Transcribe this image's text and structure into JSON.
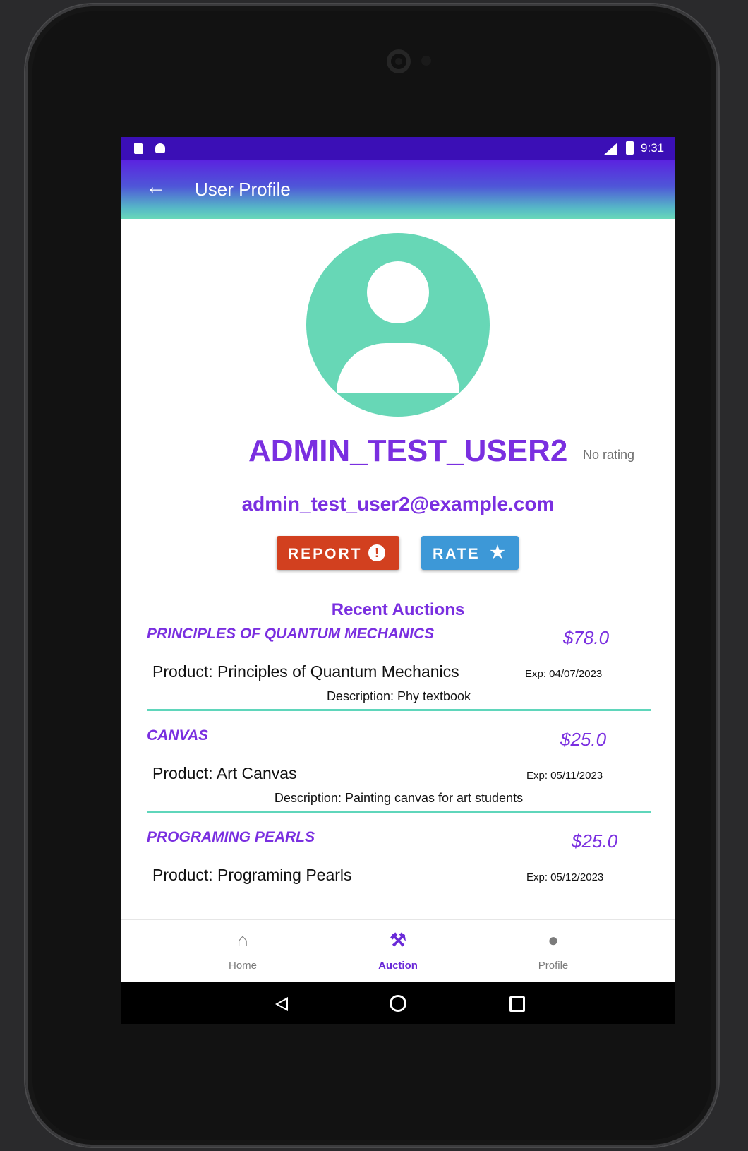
{
  "status_bar": {
    "time": "9:31"
  },
  "app_bar": {
    "title": "User Profile",
    "back_icon": "arrow-left-icon"
  },
  "profile": {
    "username": "ADMIN_TEST_USER2",
    "rating_text": "No rating",
    "email": "admin_test_user2@example.com",
    "avatar_icon": "person-avatar-icon",
    "avatar_color": "#67d7b6"
  },
  "actions": {
    "report_label": "REPORT",
    "report_icon": "exclamation-circle-icon",
    "report_glyph": "!",
    "report_color": "#d2401f",
    "rate_label": "RATE",
    "rate_icon": "star-icon",
    "rate_glyph": "★",
    "rate_color": "#3d98d7"
  },
  "recent_auctions": {
    "heading": "Recent Auctions",
    "items": [
      {
        "title": "PRINCIPLES OF QUANTUM MECHANICS",
        "price": "$78.0",
        "product": "Product: Principles of Quantum Mechanics",
        "exp": "Exp: 04/07/2023",
        "description": "Description: Phy textbook"
      },
      {
        "title": "CANVAS",
        "price": "$25.0",
        "product": "Product: Art Canvas",
        "exp": "Exp: 05/11/2023",
        "description": "Description: Painting canvas for art students"
      },
      {
        "title": "PROGRAMING PEARLS",
        "price": "$25.0",
        "product": "Product: Programing Pearls",
        "exp": "Exp: 05/12/2023",
        "description": ""
      }
    ]
  },
  "bottom_nav": {
    "items": [
      {
        "label": "Home",
        "icon": "home-icon",
        "glyph": "⌂"
      },
      {
        "label": "Auction",
        "icon": "gavel-icon",
        "glyph": "⚒",
        "active": true
      },
      {
        "label": "Profile",
        "icon": "person-icon",
        "glyph": "●"
      }
    ]
  },
  "colors": {
    "accent": "#7a2fe0",
    "status_bar": "#3b0fb6",
    "divider": "#5fd6bb"
  }
}
